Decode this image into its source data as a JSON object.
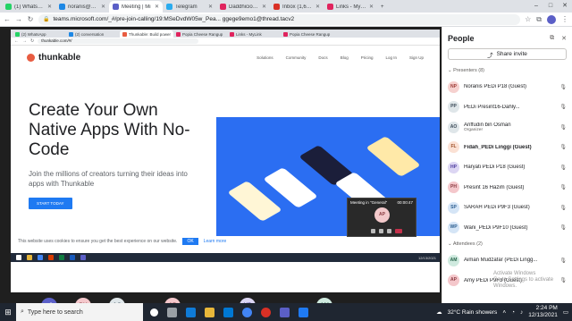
{
  "browser": {
    "tabs": [
      {
        "label": "(1) WhatsApp",
        "color": "#25d366",
        "active": false
      },
      {
        "label": "noranis@sprintb",
        "color": "#1e88e5",
        "active": false
      },
      {
        "label": "Meeting | Mi",
        "color": "#5b5fc7",
        "active": true
      },
      {
        "label": "Telegram",
        "color": "#2aabee",
        "active": false
      },
      {
        "label": "Daddhicious (Dai",
        "color": "#e0245e",
        "active": false
      },
      {
        "label": "Inbox (1,648) - u",
        "color": "#d93025",
        "active": false
      },
      {
        "label": "Links - MyLink",
        "color": "#e0245e",
        "active": false
      }
    ],
    "url": "teams.microsoft.com/_#/pre-join-calling/19:MSeDvdW05w_Pea... ggege9emo1@thread.tacv2"
  },
  "shared_screen": {
    "inner_tabs": [
      "(2) WhatsApp",
      "(2) conversation",
      "Thunkable: Build power",
      "Popia Cheese Rangup",
      "Links - MyLink",
      "Popia Cheese Rangup"
    ],
    "inner_url": "thunkable.com/#/",
    "site": {
      "logo": "thunkable",
      "menu": [
        "Solutions",
        "Community",
        "Docs",
        "Blog",
        "Pricing",
        "Log In",
        "Sign Up"
      ],
      "headline": "Create Your Own Native Apps With No-Code",
      "subtext": "Join the millions of creators turning their ideas into apps with Thunkable",
      "cta": "START TODAY",
      "cookie_text": "This website uses cookies to ensure you get the best experience on our website.",
      "cookie_ok": "OK",
      "cookie_link": "Learn more"
    },
    "popup": {
      "title": "Meeting in \"General\"",
      "time": "00:00:47",
      "initials": "AP"
    },
    "taskbar_time": "12/13/2021"
  },
  "participants_strip": [
    {
      "initials": "+6",
      "bg": "#5b5fc7",
      "fg": "#ffffff"
    },
    {
      "initials": "PH",
      "bg": "#f4c7cb",
      "fg": "#8a3a40"
    },
    {
      "initials": "AO",
      "bg": "#dfe6e9",
      "fg": "#3b4a57"
    },
    {
      "initials": "AP",
      "bg": "#f4c7cb",
      "fg": "#8a3a40"
    },
    {
      "initials": "HP",
      "bg": "#dcd6f3",
      "fg": "#4b3a9c"
    },
    {
      "initials": "AM",
      "bg": "#cfeadf",
      "fg": "#27634a"
    }
  ],
  "people_panel": {
    "title": "People",
    "share_invite": "Share invite",
    "presenters_header": "Presenters (8)",
    "presenters": [
      {
        "initials": "NP",
        "name": "Noranis PEDi P18 (Guest)",
        "bg": "#f6d1cf",
        "fg": "#9c3a34",
        "bold": false,
        "sub": ""
      },
      {
        "initials": "PP",
        "name": "PEDi Presint16-Dahly...",
        "bg": "#dfe6e9",
        "fg": "#3b4a57",
        "bold": false,
        "sub": ""
      },
      {
        "initials": "AO",
        "name": "Ariffudin bin Osman",
        "bg": "#dfe6e9",
        "fg": "#3b4a57",
        "bold": false,
        "sub": "Organizer"
      },
      {
        "initials": "FL",
        "name": "Fidah_PEDi Linggi (Guest)",
        "bg": "#fbe1d4",
        "fg": "#9a4b23",
        "bold": true,
        "sub": ""
      },
      {
        "initials": "HP",
        "name": "Haryati PEDi P18 (Guest)",
        "bg": "#dcd6f3",
        "fg": "#4b3a9c",
        "bold": false,
        "sub": ""
      },
      {
        "initials": "PH",
        "name": "Presint 16 Hazim (Guest)",
        "bg": "#f4c7cb",
        "fg": "#8a3a40",
        "bold": false,
        "sub": ""
      },
      {
        "initials": "SP",
        "name": "SARAH PEDi P9F3 (Guest)",
        "bg": "#d5e5f6",
        "fg": "#2c5d8f",
        "bold": false,
        "sub": ""
      },
      {
        "initials": "WP",
        "name": "Wani_PEDi P9F10 (Guest)",
        "bg": "#d5e5f6",
        "fg": "#2c5d8f",
        "bold": false,
        "sub": ""
      }
    ],
    "attendees_header": "Attendees (2)",
    "attendees": [
      {
        "initials": "AM",
        "name": "Aiman Mudzafar (PEDi Lingg...",
        "bg": "#cfeadf",
        "fg": "#27634a",
        "bold": false,
        "sub": ""
      },
      {
        "initials": "AP",
        "name": "Amy PEDi P9F3 (Guest)",
        "bg": "#f4c7cb",
        "fg": "#8a3a40",
        "bold": false,
        "sub": ""
      }
    ]
  },
  "watermark": {
    "line1": "Activate Windows",
    "line2": "Go to Settings to activate Windows."
  },
  "taskbar": {
    "search_placeholder": "Type here to search",
    "weather": "32°C  Rain showers",
    "time": "2:24 PM",
    "date": "12/13/2021"
  }
}
